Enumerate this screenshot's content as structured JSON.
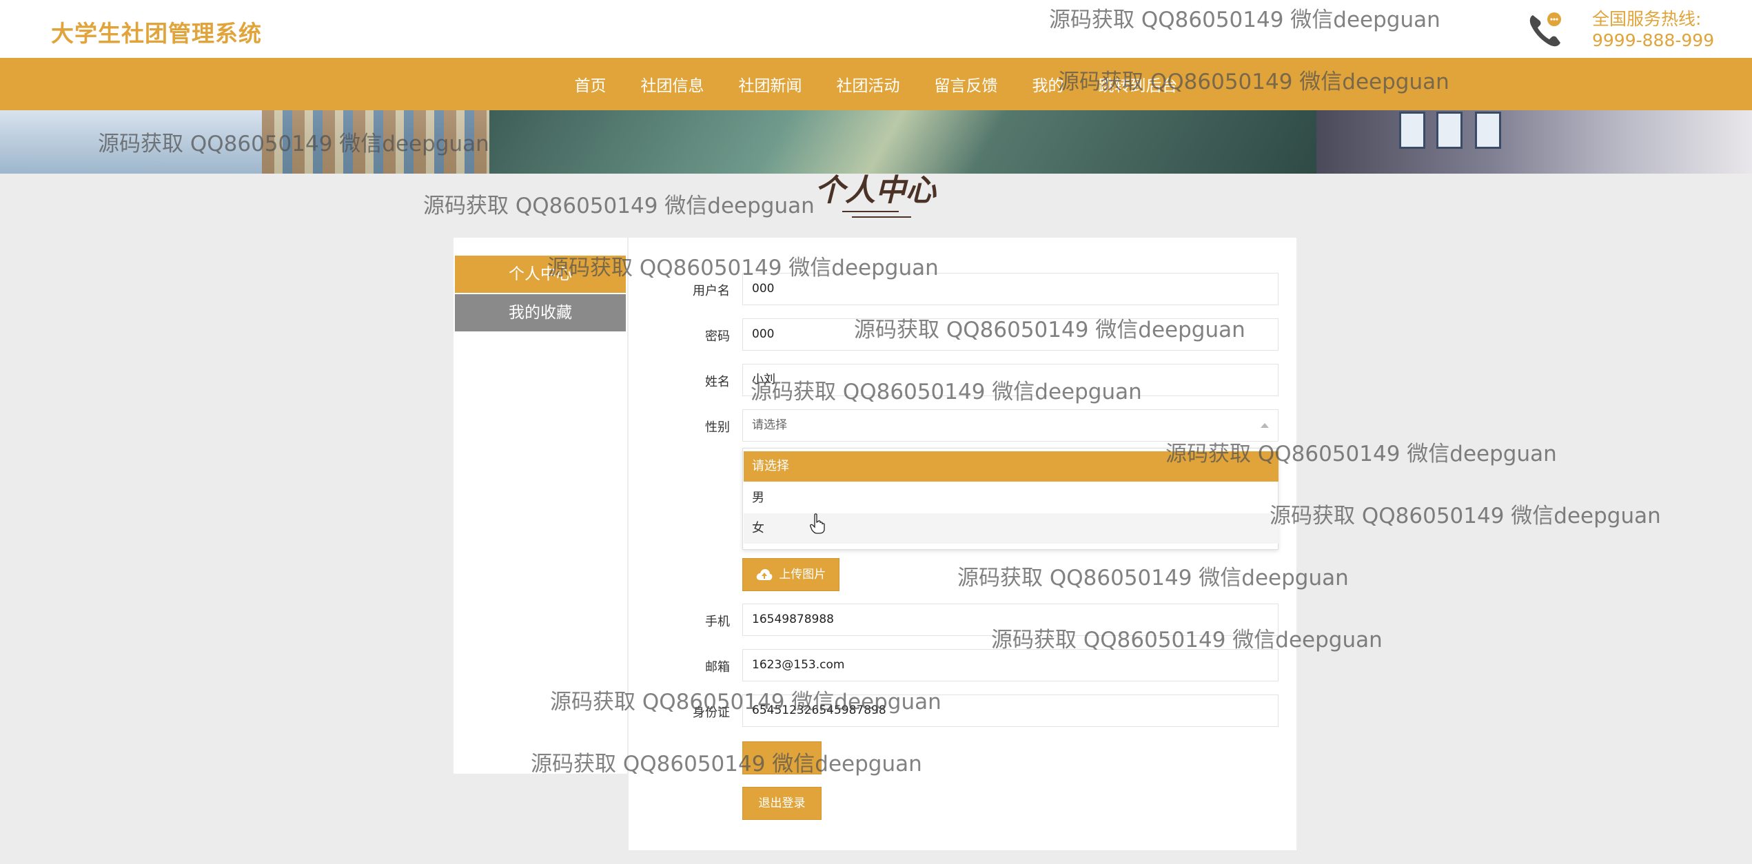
{
  "header": {
    "brand": "大学生社团管理系统",
    "hotline_label": "全国服务热线:",
    "hotline_number": "9999-888-999",
    "hotline_icon": "phone-chat-icon",
    "accent_color": "#e0a43a"
  },
  "nav": {
    "items": [
      {
        "label": "首页"
      },
      {
        "label": "社团信息"
      },
      {
        "label": "社团新闻"
      },
      {
        "label": "社团活动"
      },
      {
        "label": "留言反馈"
      },
      {
        "label": "我的"
      },
      {
        "label": "跳转到后台"
      }
    ]
  },
  "page": {
    "title": "个人中心"
  },
  "side_menu": {
    "items": [
      {
        "label": "个人中心",
        "active": true
      },
      {
        "label": "我的收藏",
        "active": false
      }
    ]
  },
  "form": {
    "username": {
      "label": "用户名",
      "value": "000"
    },
    "password": {
      "label": "密码",
      "value": "000"
    },
    "name": {
      "label": "姓名",
      "value": "小刘"
    },
    "gender": {
      "label": "性别",
      "placeholder": "请选择",
      "options": [
        "请选择",
        "男",
        "女"
      ],
      "highlighted": "请选择",
      "hovered": "女"
    },
    "upload_label": "上传图片",
    "phone": {
      "label": "手机",
      "value": "16549878988"
    },
    "email": {
      "label": "邮箱",
      "value": "1623@153.com"
    },
    "id_card": {
      "label": "身份证",
      "value": "654512326545987898"
    },
    "save_label": "",
    "logout_label": "退出登录"
  },
  "watermark": {
    "text": "源码获取 QQ86050149 微信deepguan"
  }
}
